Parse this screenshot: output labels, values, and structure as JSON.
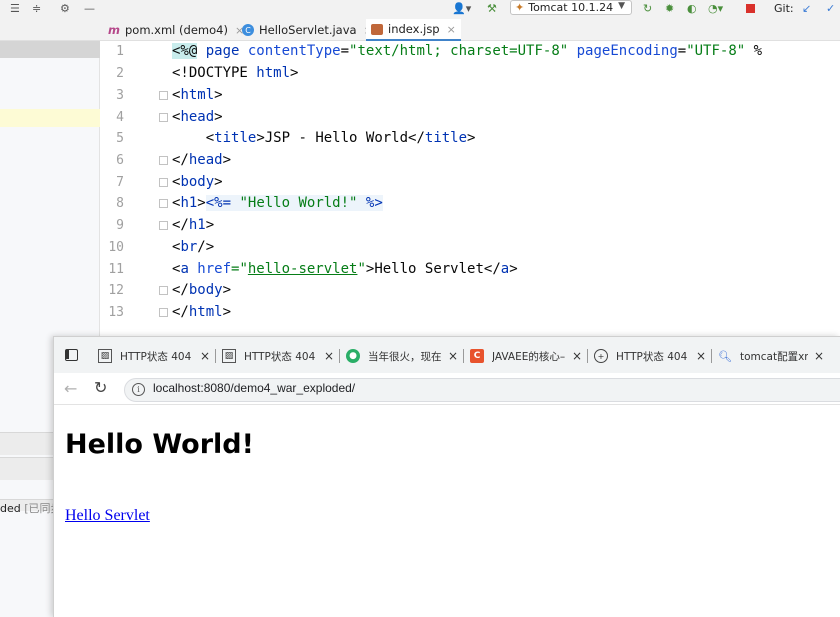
{
  "ide": {
    "run_config": "Tomcat 10.1.24",
    "git_label": "Git:",
    "tabs": [
      {
        "label": "pom.xml (demo4)",
        "icon": "maven-icon"
      },
      {
        "label": "HelloServlet.java",
        "icon": "java-class-icon"
      },
      {
        "label": "index.jsp",
        "icon": "jsp-file-icon",
        "active": true
      }
    ],
    "project_log": {
      "text": "ded",
      "suffix": "[已同步"
    },
    "line_numbers": [
      "1",
      "2",
      "3",
      "4",
      "5",
      "6",
      "7",
      "8",
      "9",
      "10",
      "11",
      "12",
      "13"
    ],
    "code": {
      "l1": {
        "a": "<%@",
        "b": " page ",
        "c": "contentType",
        "d": "=",
        "e": "\"text/html; charset=UTF-8\"",
        "f": " pageEncoding",
        "g": "=",
        "h": "\"UTF-8\"",
        "i": " %"
      },
      "l2": {
        "a": "<!DOCTYPE ",
        "b": "html",
        "c": ">"
      },
      "l3": {
        "a": "<",
        "b": "html",
        "c": ">"
      },
      "l4": {
        "a": "<",
        "b": "head",
        "c": ">"
      },
      "l5": {
        "a": "    <",
        "b": "title",
        "c": ">JSP - Hello World</",
        "d": "title",
        "e": ">"
      },
      "l6": {
        "a": "</",
        "b": "head",
        "c": ">"
      },
      "l7": {
        "a": "<",
        "b": "body",
        "c": ">"
      },
      "l8": {
        "a": "<",
        "b": "h1",
        "c": ">",
        "d": "<%=",
        "e": " \"Hello World!\" ",
        "f": "%>"
      },
      "l9": {
        "a": "</",
        "b": "h1",
        "c": ">"
      },
      "l10": {
        "a": "<",
        "b": "br",
        "c": "/>"
      },
      "l11": {
        "a": "<",
        "b": "a ",
        "c": "href",
        "d": "=\"",
        "e": "hello-servlet",
        "f": "\"",
        "g": ">Hello Servlet</",
        "h": "a",
        "i": ">"
      },
      "l12": {
        "a": "</",
        "b": "body",
        "c": ">"
      },
      "l13": {
        "a": "</",
        "b": "html",
        "c": ">"
      }
    }
  },
  "browser": {
    "tabs": [
      {
        "label": "HTTP状态 404 –",
        "icon": "broken-image-icon"
      },
      {
        "label": "HTTP状态 404 –",
        "icon": "broken-image-icon"
      },
      {
        "label": "当年很火，现在",
        "icon": "wechat-icon"
      },
      {
        "label": "JAVAEE的核心–",
        "icon": "csdn-icon"
      },
      {
        "label": "HTTP状态 404 –",
        "icon": "globe-icon"
      },
      {
        "label": "tomcat配置xm",
        "icon": "search-icon"
      }
    ],
    "url": "localhost:8080/demo4_war_exploded/",
    "page_heading": "Hello World!",
    "page_link": "Hello Servlet"
  },
  "colors": {
    "accent": "#4083c9",
    "code_tag": "#0033b3",
    "code_string": "#067d17",
    "link": "#0000ee",
    "jsp_highlight": "#c8ecec"
  }
}
